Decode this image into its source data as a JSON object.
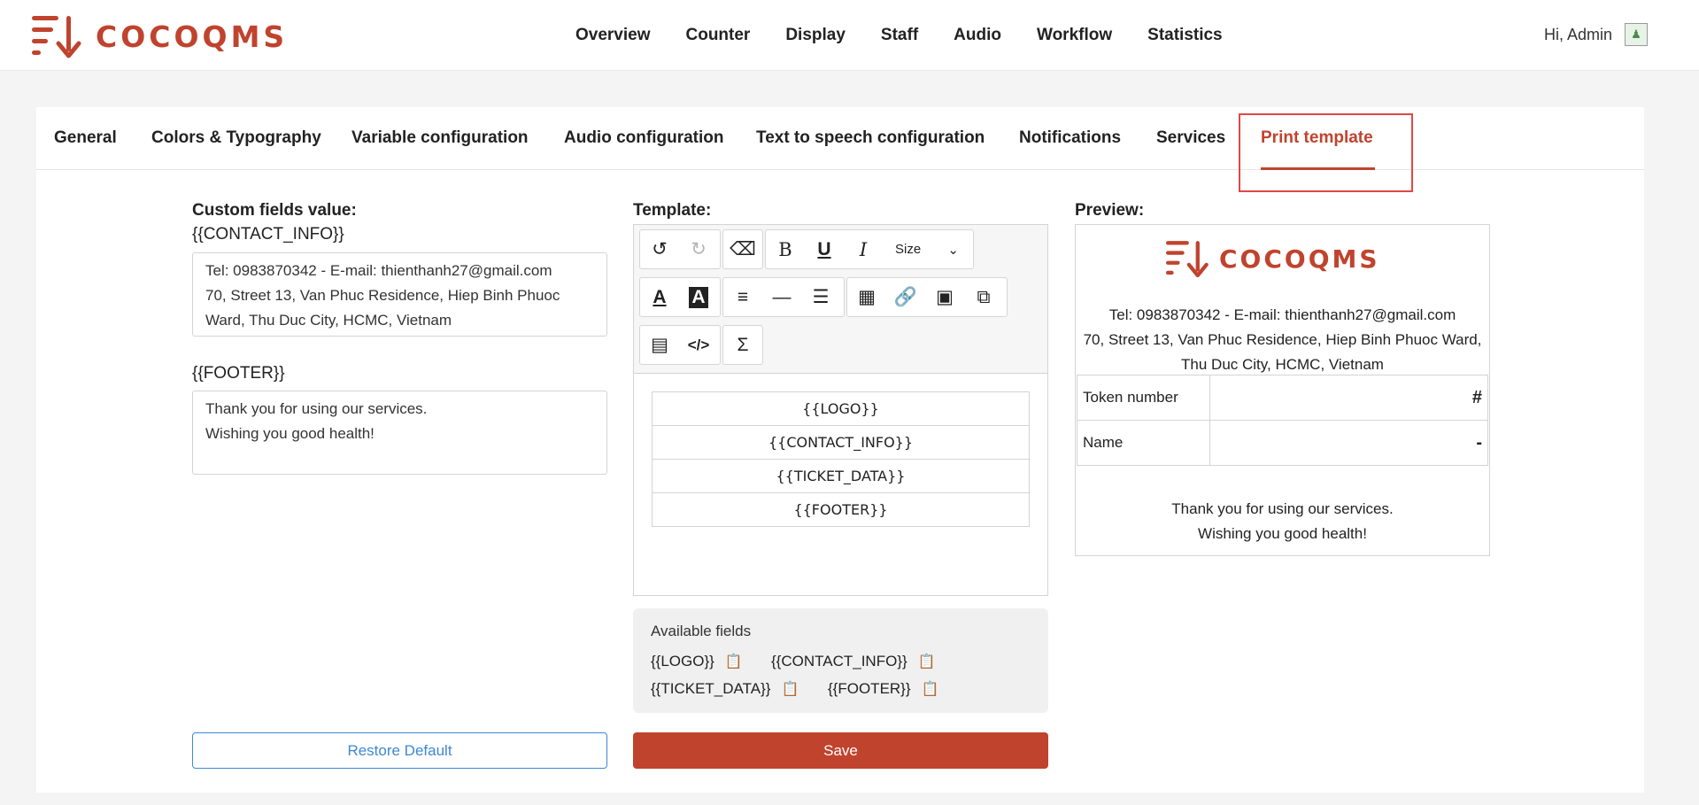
{
  "brand": {
    "name": "COCOQMS",
    "color": "#c0432e"
  },
  "nav": [
    "Overview",
    "Counter",
    "Display",
    "Staff",
    "Audio",
    "Workflow",
    "Statistics"
  ],
  "user": {
    "greeting": "Hi, Admin",
    "avatar_icon": "user-avatar-icon"
  },
  "tabs": [
    "General",
    "Colors & Typography",
    "Variable configuration",
    "Audio configuration",
    "Text to speech configuration",
    "Notifications",
    "Services",
    "Print template"
  ],
  "active_tab": "Print template",
  "custom_fields": {
    "title": "Custom fields value:",
    "contact_label": "{{CONTACT_INFO}}",
    "contact_lines": [
      "Tel: 0983870342 - E-mail: thienthanh27@gmail.com",
      "70, Street 13, Van Phuc Residence, Hiep Binh Phuoc",
      "Ward, Thu Duc City, HCMC, Vietnam"
    ],
    "footer_label": "{{FOOTER}}",
    "footer_lines": [
      "Thank you for using our services.",
      "Wishing you good health!"
    ]
  },
  "template": {
    "title": "Template:",
    "size_label": "Size",
    "rows": [
      "{{LOGO}}",
      "{{CONTACT_INFO}}",
      "{{TICKET_DATA}}",
      "{{FOOTER}}"
    ]
  },
  "available_fields": {
    "title": "Available fields",
    "items": [
      "{{LOGO}}",
      "{{CONTACT_INFO}}",
      "{{TICKET_DATA}}",
      "{{FOOTER}}"
    ]
  },
  "preview": {
    "title": "Preview:",
    "contact_lines": [
      "Tel: 0983870342 - E-mail: thienthanh27@gmail.com",
      "70, Street 13, Van Phuc Residence, Hiep Binh Phuoc Ward,",
      "Thu Duc City, HCMC, Vietnam"
    ],
    "rows": [
      {
        "label": "Token number",
        "value": "#"
      },
      {
        "label": "Name",
        "value": "-"
      }
    ],
    "footer_lines": [
      "Thank you for using our services.",
      "Wishing you good health!"
    ]
  },
  "buttons": {
    "restore": "Restore Default",
    "save": "Save"
  }
}
